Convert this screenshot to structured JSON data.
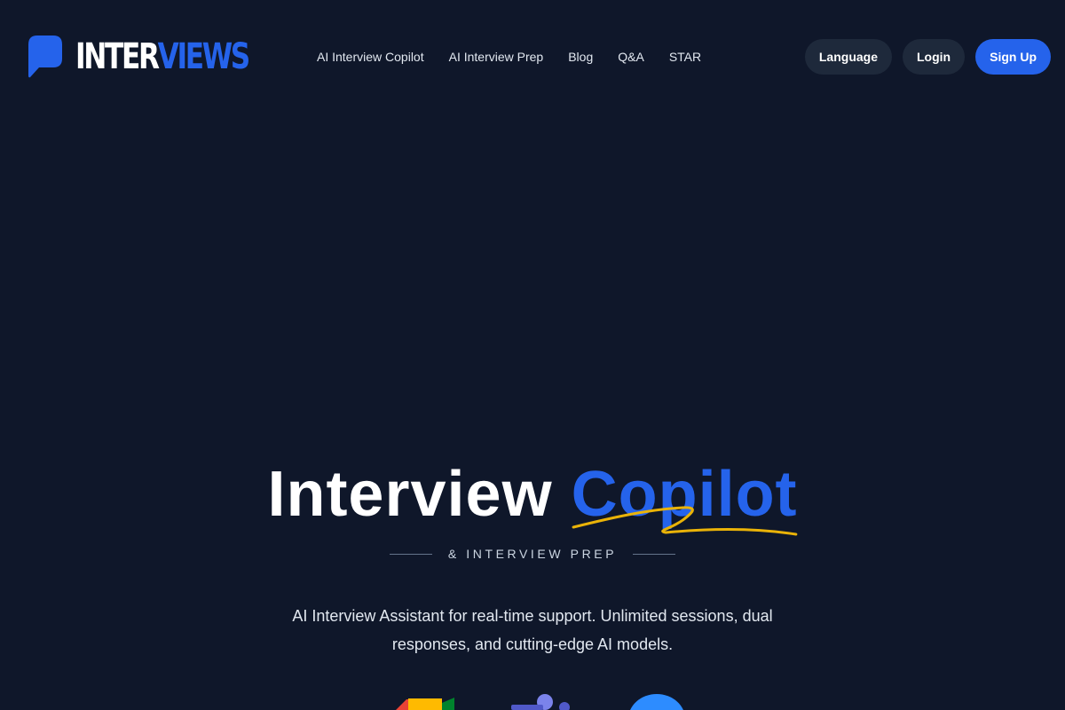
{
  "header": {
    "logo": {
      "text_a": "INTER",
      "text_b": "VIEWS",
      "icon": "chat-bubble-icon"
    },
    "nav": [
      {
        "label": "AI Interview Copilot"
      },
      {
        "label": "AI Interview Prep"
      },
      {
        "label": "Blog"
      },
      {
        "label": "Q&A"
      },
      {
        "label": "STAR"
      }
    ],
    "actions": {
      "language_label": "Language",
      "login_label": "Login",
      "signup_label": "Sign Up"
    }
  },
  "hero": {
    "title_word1": "Interview",
    "title_word2": "Copilot",
    "subtitle": "& INTERVIEW PREP",
    "description": "AI Interview Assistant for real-time support. Unlimited sessions, dual responses, and cutting-edge AI models."
  },
  "platforms": [
    {
      "icon": "google-meet-icon"
    },
    {
      "icon": "microsoft-teams-icon"
    },
    {
      "icon": "zoom-icon"
    }
  ],
  "colors": {
    "background": "#0f172a",
    "accent": "#2563eb",
    "button_dark": "#1e293b",
    "squiggle": "#eab308"
  }
}
